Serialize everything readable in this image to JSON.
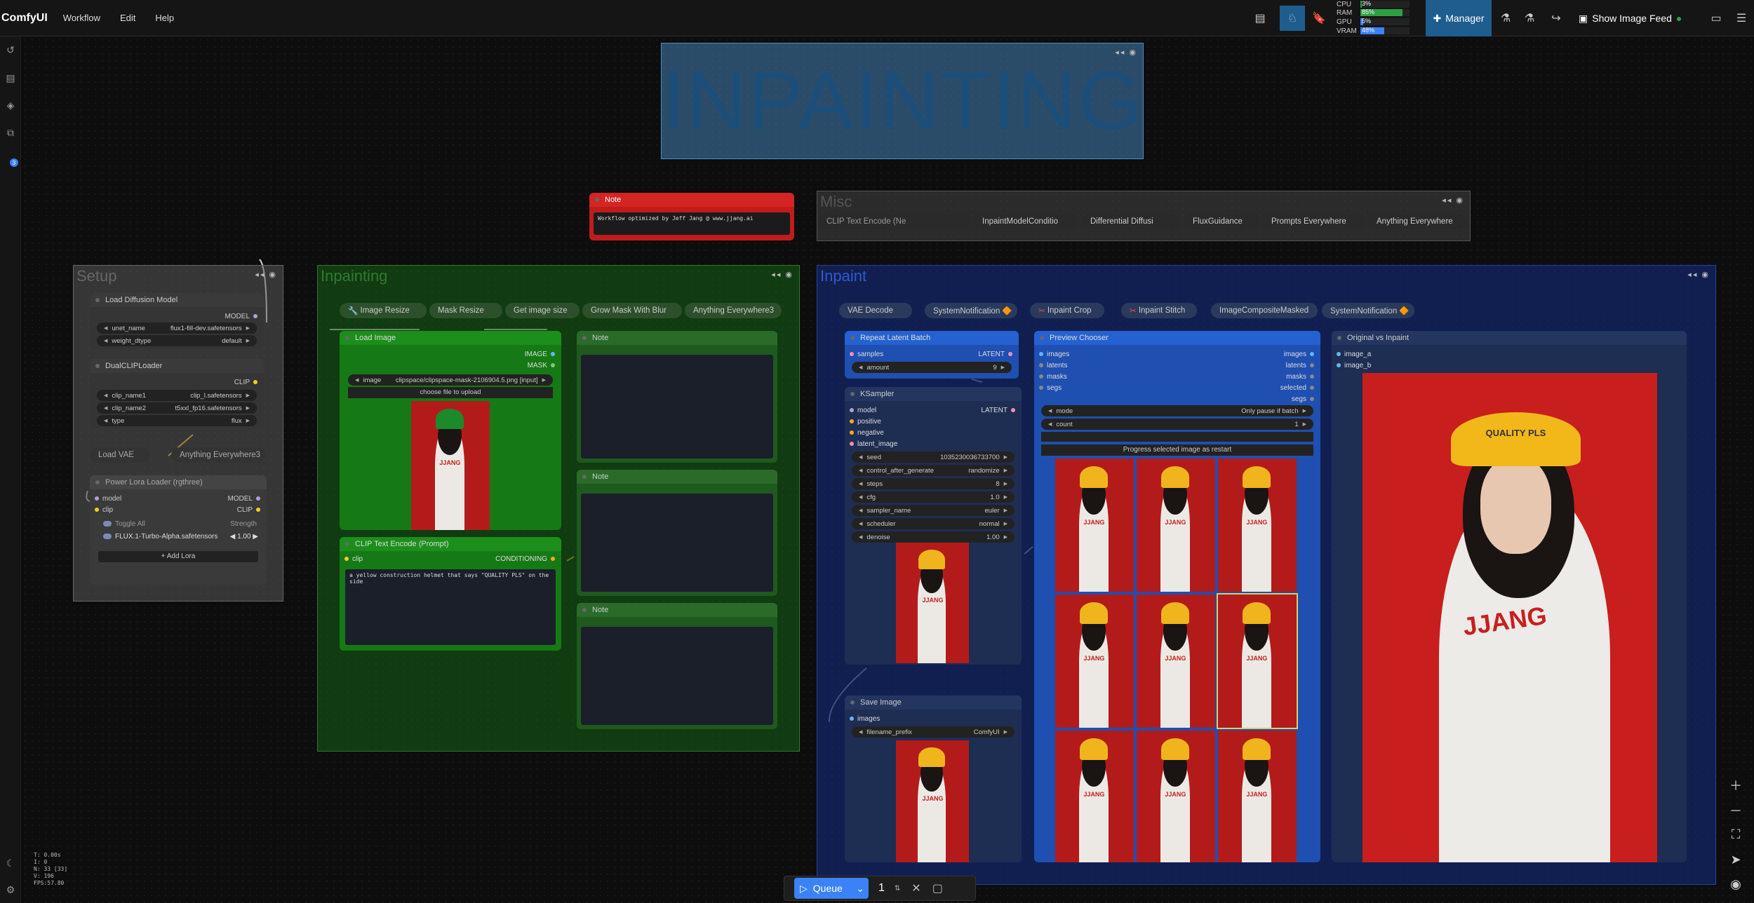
{
  "app": {
    "brand": "ComfyUI",
    "menus": [
      "Workflow",
      "Edit",
      "Help"
    ]
  },
  "topbar": {
    "stats": [
      {
        "label": "CPU",
        "value": "3%",
        "fill": 0.03,
        "color": "#2ea043"
      },
      {
        "label": "RAM",
        "value": "85%",
        "fill": 0.85,
        "color": "#2ea043"
      },
      {
        "label": "GPU",
        "value": "5%",
        "fill": 0.05,
        "color": "#3b82f6"
      },
      {
        "label": "VRAM",
        "value": "48%",
        "fill": 0.48,
        "color": "#3b82f6"
      }
    ],
    "manager_label": "Manager",
    "show_feed_label": "Show Image Feed"
  },
  "sidebar": {
    "badge": "3"
  },
  "title_group": {
    "text": "INPAINTING"
  },
  "note_node": {
    "title": "Note",
    "text": "Workflow optimized by Jeff Jang @ www.jjang.ai"
  },
  "misc_group": {
    "title": "Misc",
    "pills": [
      "CLIP Text Encode (Ne",
      "InpaintModelConditio",
      "Differential Diffusi",
      "FluxGuidance",
      "Prompts Everywhere",
      "Anything Everywhere"
    ]
  },
  "setup_group": {
    "title": "Setup",
    "load_model": {
      "title": "Load Diffusion Model",
      "out": "MODEL",
      "unet_label": "unet_name",
      "unet_value": "flux1-fill-dev.safetensors",
      "dtype_label": "weight_dtype",
      "dtype_value": "default"
    },
    "dual_clip": {
      "title": "DualCLIPLoader",
      "out": "CLIP",
      "c1_label": "clip_name1",
      "c1_value": "clip_l.safetensors",
      "c2_label": "clip_name2",
      "c2_value": "t5xxl_fp16.safetensors",
      "type_label": "type",
      "type_value": "flux"
    },
    "load_vae": "Load VAE",
    "anything3": "Anything Everywhere3",
    "lora": {
      "title": "Power Lora Loader (rgthree)",
      "in_model": "model",
      "in_clip": "clip",
      "out_model": "MODEL",
      "out_clip": "CLIP",
      "toggle_all": "Toggle All",
      "strength": "Strength",
      "lora_name": "FLUX.1-Turbo-Alpha.safetensors",
      "lora_strength": "1.00",
      "add_lora": "+ Add Lora"
    }
  },
  "inpainting_group": {
    "title": "Inpainting",
    "pills": [
      "Image Resize",
      "Mask Resize",
      "Get image size",
      "Grow Mask With Blur",
      "Anything Everywhere3"
    ],
    "load_image": {
      "title": "Load Image",
      "out_image": "IMAGE",
      "out_mask": "MASK",
      "image_label": "image",
      "image_value": "clipspace/clipspace-mask-2106904.5.png [input]",
      "upload": "choose file to upload"
    },
    "clip_encode": {
      "title": "CLIP Text Encode (Prompt)",
      "in": "clip",
      "out": "CONDITIONING",
      "prompt": "a yellow construction helmet that says \"QUALITY PLS\" on the side"
    },
    "notes": [
      "Note",
      "Note",
      "Note"
    ]
  },
  "inpaint_group": {
    "title": "Inpaint",
    "pills": [
      "VAE Decode",
      "SystemNotification 🔶",
      "Inpaint Crop",
      "Inpaint Stitch",
      "ImageCompositeMasked",
      "SystemNotification 🔶"
    ],
    "repeat": {
      "title": "Repeat Latent Batch",
      "in": "samples",
      "out": "LATENT",
      "amount_label": "amount",
      "amount_value": "9"
    },
    "ksampler": {
      "title": "KSampler",
      "out": "LATENT",
      "inputs": [
        "model",
        "positive",
        "negative",
        "latent_image"
      ],
      "widgets": [
        {
          "label": "seed",
          "value": "1035230036733700"
        },
        {
          "label": "control_after_generate",
          "value": "randomize"
        },
        {
          "label": "steps",
          "value": "8"
        },
        {
          "label": "cfg",
          "value": "1.0"
        },
        {
          "label": "sampler_name",
          "value": "euler"
        },
        {
          "label": "scheduler",
          "value": "normal"
        },
        {
          "label": "denoise",
          "value": "1.00"
        }
      ]
    },
    "save": {
      "title": "Save Image",
      "in": "images",
      "prefix_label": "filename_prefix",
      "prefix_value": "ComfyUI"
    },
    "chooser": {
      "title": "Preview Chooser",
      "inputs": [
        "images",
        "latents",
        "masks",
        "segs"
      ],
      "outputs": [
        "images",
        "latents",
        "masks",
        "selected",
        "segs"
      ],
      "mode_label": "mode",
      "mode_value": "Only pause if batch",
      "count_label": "count",
      "count_value": "1",
      "progress_btn": "Progress selected image as restart",
      "helmet_text": "QUALITY PLS"
    },
    "compare": {
      "title": "Original vs Inpaint",
      "in_a": "image_a",
      "in_b": "image_b",
      "helmet_text": "QUALITY PLS",
      "shirt_text": "JJANG"
    }
  },
  "photo_shirt_text": "JJANG",
  "queue": {
    "label": "Queue",
    "count": "1"
  },
  "perf": [
    "T: 0.00s",
    "I: 0",
    "N: 33 [33]",
    "V: 196",
    "FPS:57.80"
  ]
}
